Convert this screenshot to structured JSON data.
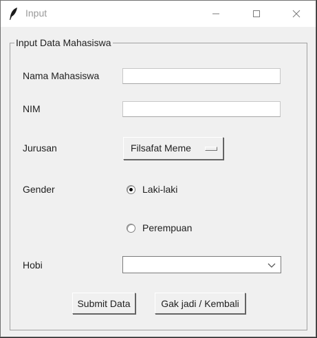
{
  "window": {
    "title": "Input",
    "icon": "feather-icon",
    "controls": [
      "minimize-icon",
      "maximize-icon",
      "close-icon"
    ]
  },
  "form": {
    "group_title": "Input Data Mahasiswa",
    "nama": {
      "label": "Nama Mahasiswa",
      "value": ""
    },
    "nim": {
      "label": "NIM",
      "value": ""
    },
    "jurusan": {
      "label": "Jurusan",
      "selected": "Filsafat Meme"
    },
    "gender": {
      "label": "Gender",
      "options": [
        {
          "label": "Laki-laki",
          "checked": true
        },
        {
          "label": "Perempuan",
          "checked": false
        }
      ]
    },
    "hobi": {
      "label": "Hobi",
      "selected": ""
    },
    "buttons": {
      "submit": "Submit Data",
      "back": "Gak jadi / Kembali"
    }
  }
}
